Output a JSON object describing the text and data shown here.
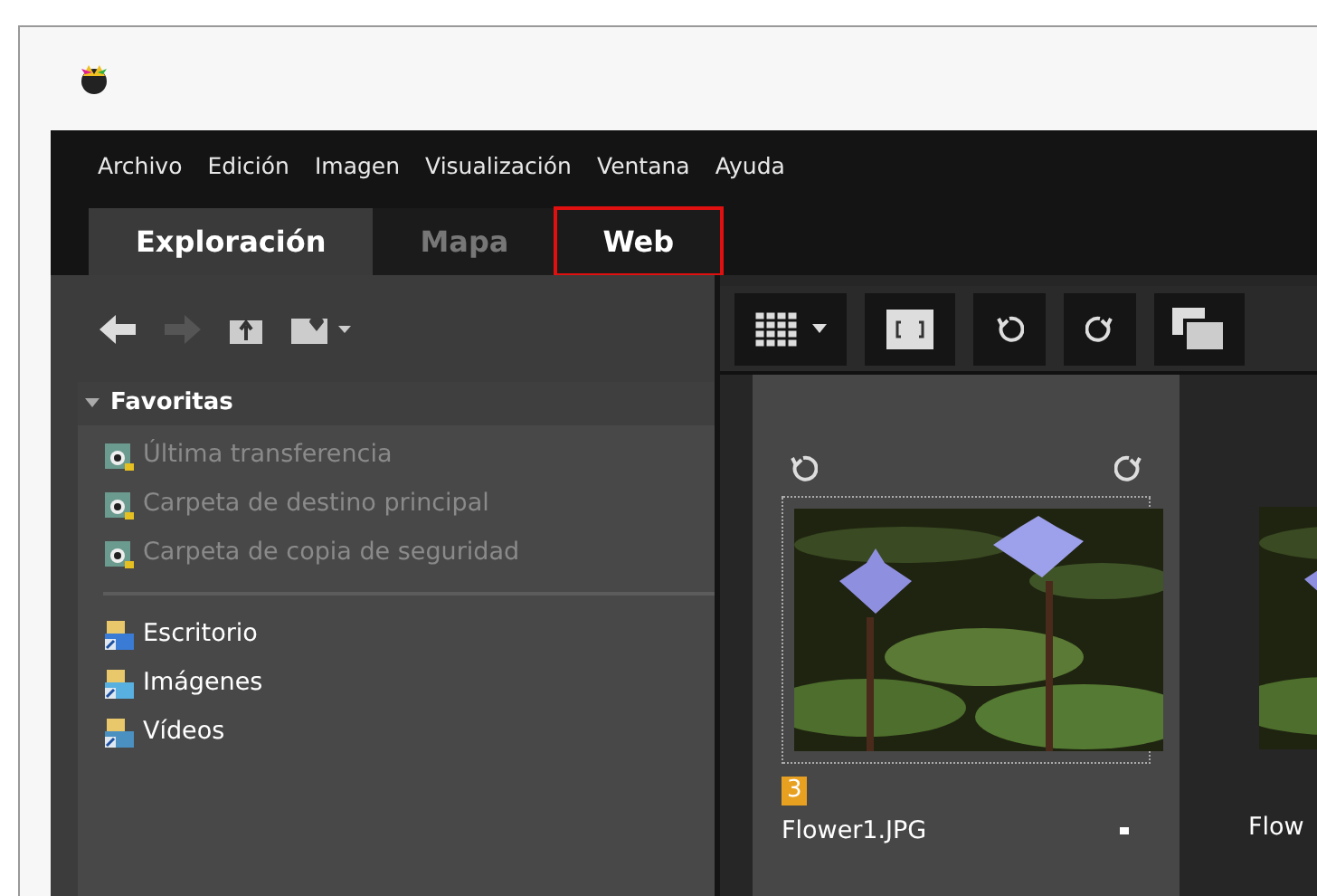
{
  "menu": [
    "Archivo",
    "Edición",
    "Imagen",
    "Visualización",
    "Ventana",
    "Ayuda"
  ],
  "tabs": [
    {
      "label": "Exploración",
      "selected": true,
      "disabled": false,
      "highlighted": false
    },
    {
      "label": "Mapa",
      "selected": false,
      "disabled": true,
      "highlighted": false
    },
    {
      "label": "Web",
      "selected": false,
      "disabled": false,
      "highlighted": true
    }
  ],
  "sidebar": {
    "section": {
      "title": "Favoritas",
      "expanded": true
    },
    "favorites": [
      {
        "label": "Última transferencia",
        "disabled": true
      },
      {
        "label": "Carpeta de destino principal",
        "disabled": true
      },
      {
        "label": "Carpeta de copia de seguridad",
        "disabled": true
      }
    ],
    "folders": [
      {
        "label": "Escritorio",
        "kind": "desktop"
      },
      {
        "label": "Imágenes",
        "kind": "pictures"
      },
      {
        "label": "Vídeos",
        "kind": "videos"
      }
    ]
  },
  "thumbnails": [
    {
      "filename": "Flower1.JPG",
      "badge": "3",
      "selected": true
    },
    {
      "filename": "Flow",
      "selected": false
    }
  ]
}
